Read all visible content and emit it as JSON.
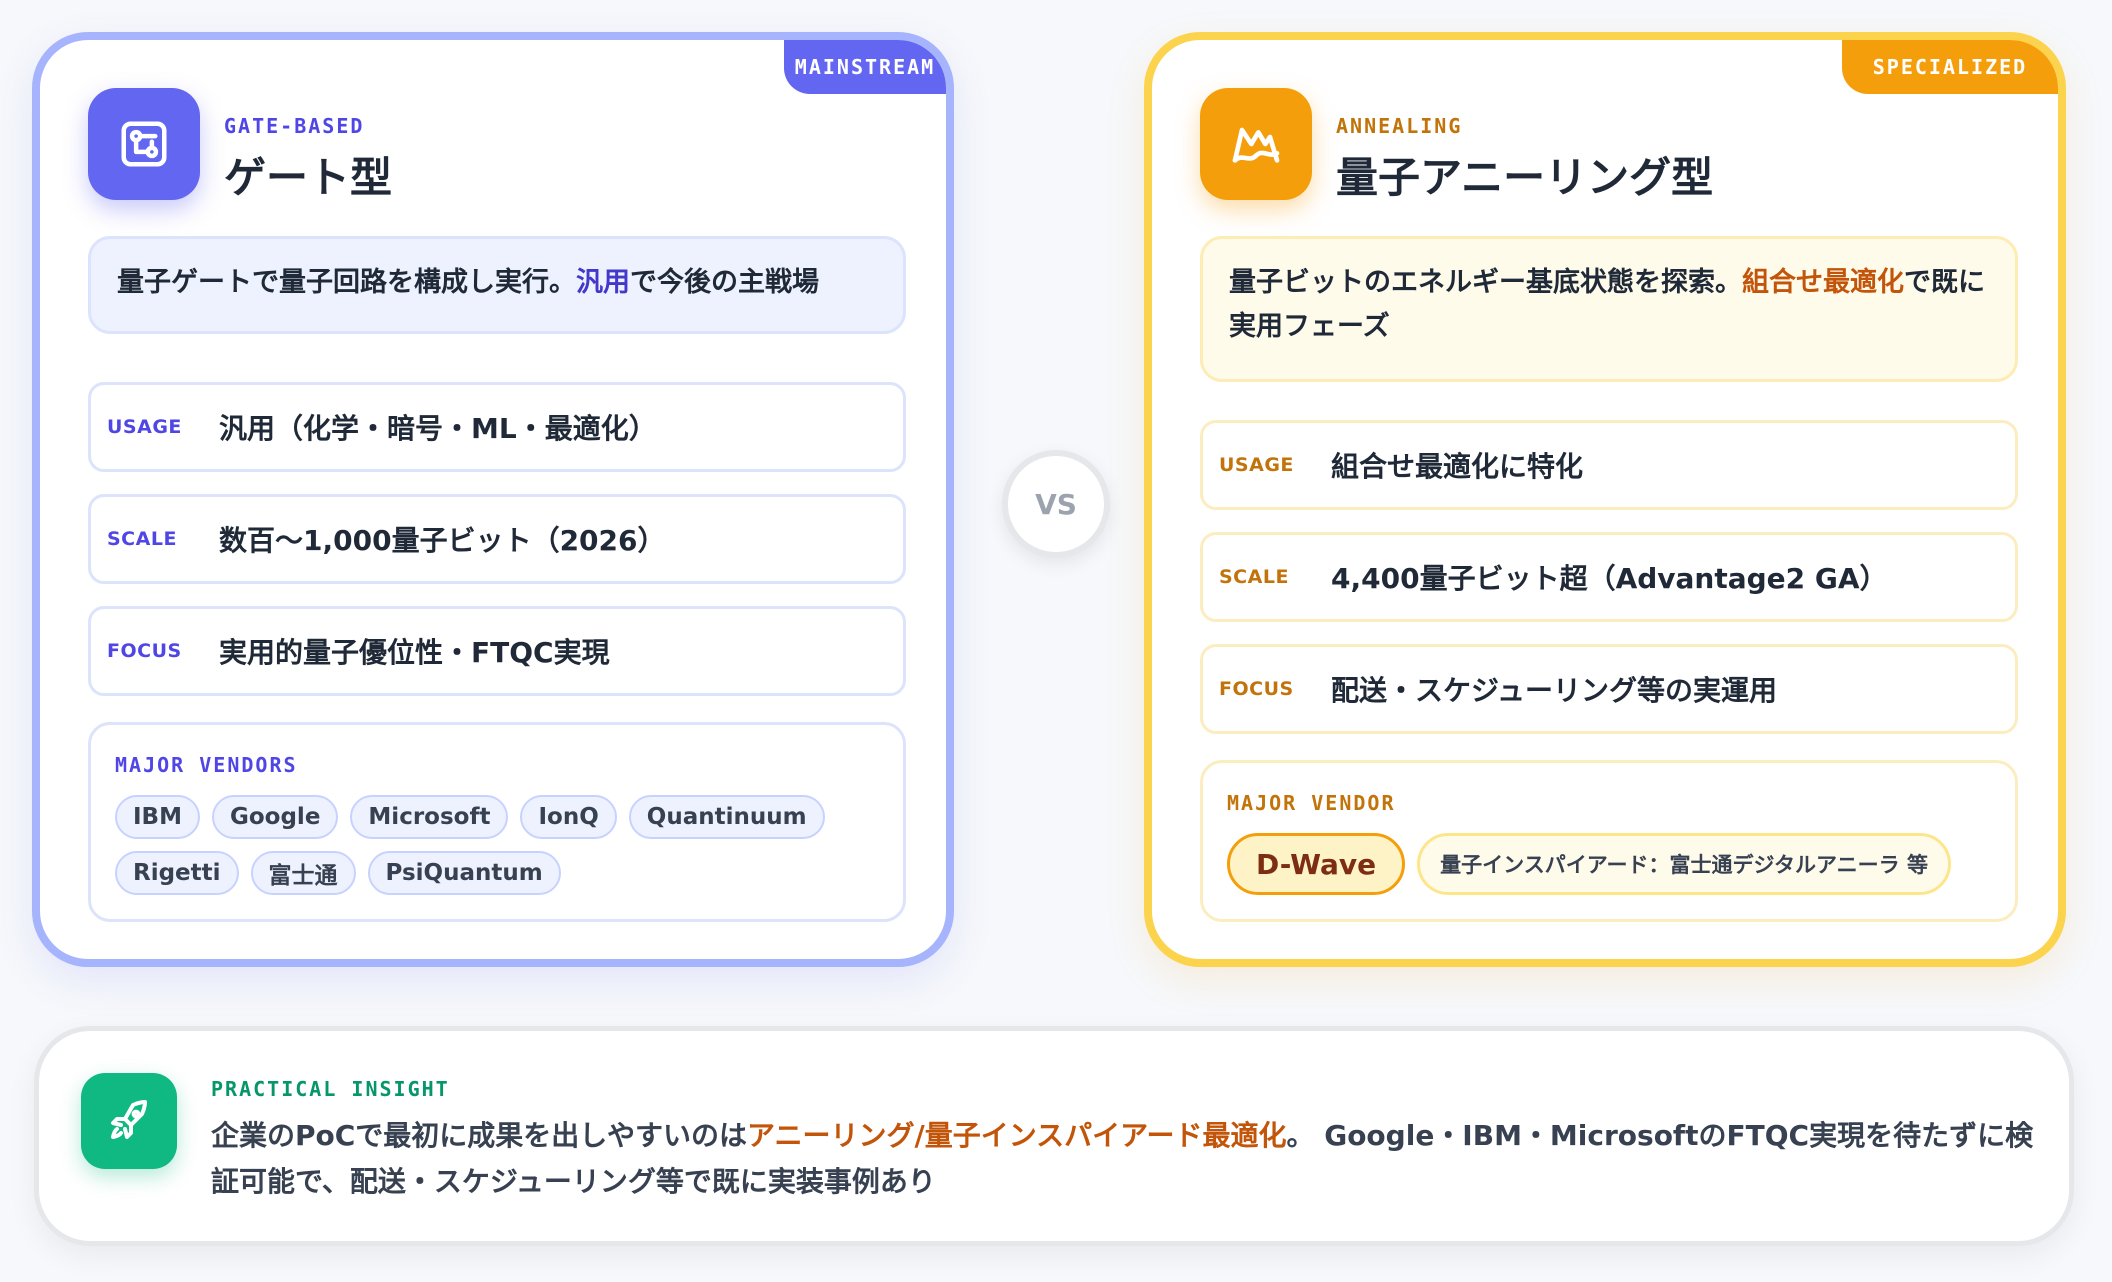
{
  "gate": {
    "ribbon": "MAINSTREAM",
    "kicker": "GATE-BASED",
    "title": "ゲート型",
    "desc_before": "量子ゲートで量子回路を構成し実行。",
    "desc_highlight": "汎用",
    "desc_after": "で今後の主戦場",
    "rows": [
      {
        "label": "USAGE",
        "value": "汎用（化学・暗号・ML・最適化）"
      },
      {
        "label": "SCALE",
        "value": "数百〜1,000量子ビット（2026）"
      },
      {
        "label": "FOCUS",
        "value": "実用的量子優位性・FTQC実現"
      }
    ],
    "vendors_heading": "MAJOR VENDORS",
    "vendors": [
      "IBM",
      "Google",
      "Microsoft",
      "IonQ",
      "Quantinuum",
      "Rigetti",
      "富士通",
      "PsiQuantum"
    ]
  },
  "vs_label": "VS",
  "anneal": {
    "ribbon": "SPECIALIZED",
    "kicker": "ANNEALING",
    "title": "量子アニーリング型",
    "desc_before": "量子ビットのエネルギー基底状態を探索。",
    "desc_highlight": "組合せ最適化",
    "desc_after": "で既に実用フェーズ",
    "rows": [
      {
        "label": "USAGE",
        "value": "組合せ最適化に特化"
      },
      {
        "label": "SCALE",
        "value": "4,400量子ビット超（Advantage2 GA）"
      },
      {
        "label": "FOCUS",
        "value": "配送・スケジューリング等の実運用"
      }
    ],
    "vendors_heading": "MAJOR VENDOR",
    "main_vendor": "D-Wave",
    "sub_vendor": "量子インスパイアード：富士通デジタルアニーラ 等"
  },
  "insight": {
    "kicker": "PRACTICAL INSIGHT",
    "text_before": "企業のPoCで最初に成果を出しやすいのは",
    "text_highlight": "アニーリング/量子インスパイアード最適化",
    "text_after": "。 Google・IBM・MicrosoftのFTQC実現を待たずに検証可能で、配送・スケジューリング等で既に実装事例あり"
  },
  "colors": {
    "gate_accent": "#6366f1",
    "anneal_accent": "#f59e0b",
    "insight_accent": "#10b981",
    "highlight_orange": "#c2550a"
  },
  "icons": {
    "gate": "circuit-icon",
    "anneal": "mountain-wave-icon",
    "insight": "rocket-icon"
  }
}
